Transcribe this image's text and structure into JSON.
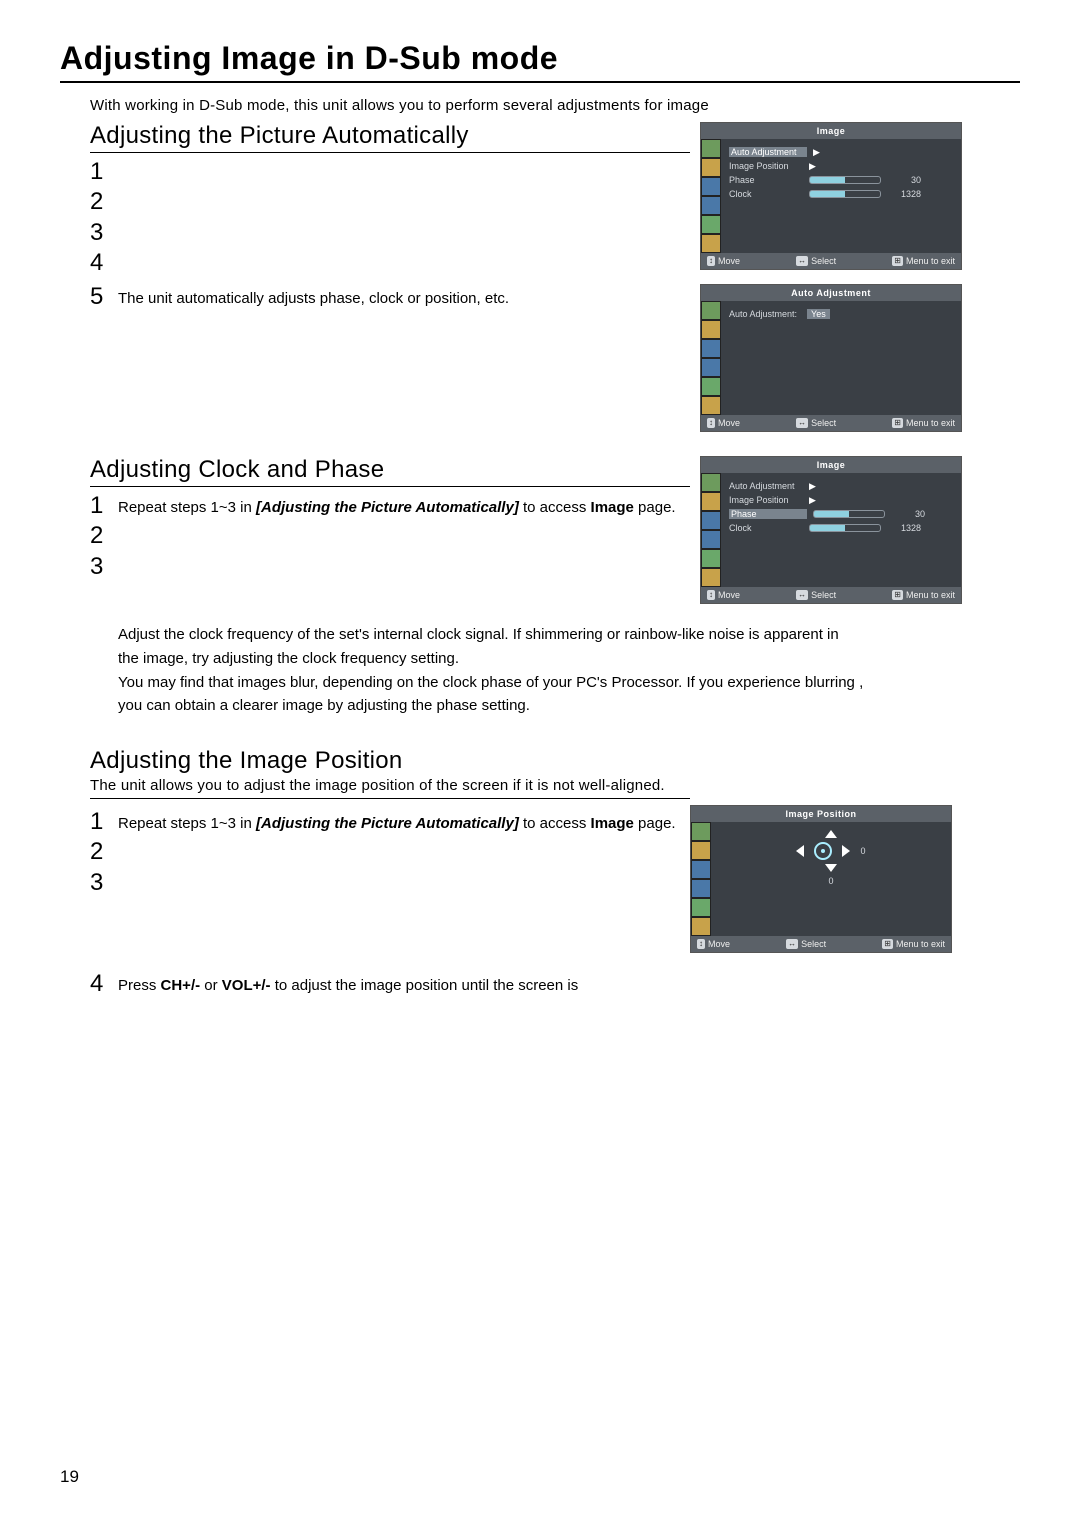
{
  "title": "Adjusting Image in D-Sub mode",
  "intro": "With working in D-Sub mode, this unit allows you to perform several adjustments for image",
  "sectionA": {
    "heading": "Adjusting the Picture Automatically",
    "steps": [
      "1",
      "2",
      "3",
      "4",
      "5"
    ],
    "note": "The unit automatically adjusts phase, clock or position, etc."
  },
  "sectionB": {
    "heading": "Adjusting Clock and Phase",
    "step1_pre": "Repeat steps 1~3 in ",
    "step1_ref": "[Adjusting the Picture Automatically]",
    "step1_post": " to access ",
    "step1_bold": "Image",
    "step1_end": " page.",
    "steps_rest": [
      "2",
      "3"
    ],
    "para1": "Adjust the clock frequency of the set's internal clock signal. If shimmering or rainbow-like noise is apparent in",
    "para2": "the image, try adjusting the clock frequency setting.",
    "para3": "You may find that images blur, depending on the clock phase of your PC's Processor. If you experience blurring ,",
    "para4": "you can obtain a clearer image by adjusting the phase setting."
  },
  "sectionC": {
    "heading": "Adjusting the Image Position",
    "intro": "The unit allows you to adjust the image position of the screen if it is not well-aligned.",
    "step1_pre": "Repeat steps 1~3 in ",
    "step1_ref": "[Adjusting the Picture Automatically]",
    "step1_post": " to access ",
    "step1_bold": "Image",
    "step1_end": " page.",
    "steps_rest": [
      "2",
      "3"
    ],
    "step4_num": "4",
    "step4_pre": "Press  ",
    "step4_b1": "CH+/-",
    "step4_mid": "  or  ",
    "step4_b2": "VOL+/-",
    "step4_post": "  to adjust the image position until the screen is"
  },
  "osd": {
    "imageTitle": "Image",
    "autoAdjTitle": "Auto Adjustment",
    "imgPosTitle": "Image Position",
    "rows": {
      "autoAdj": "Auto Adjustment",
      "imgPos": "Image Position",
      "phase": "Phase",
      "clock": "Clock"
    },
    "vals": {
      "phase": "30",
      "clock": "1328"
    },
    "autoAdjLine": "Auto Adjustment:",
    "yes": "Yes",
    "pos0a": "0",
    "pos0b": "0",
    "footer": {
      "move": "Move",
      "select": "Select",
      "menu": "Menu to exit"
    }
  },
  "pageNumber": "19"
}
